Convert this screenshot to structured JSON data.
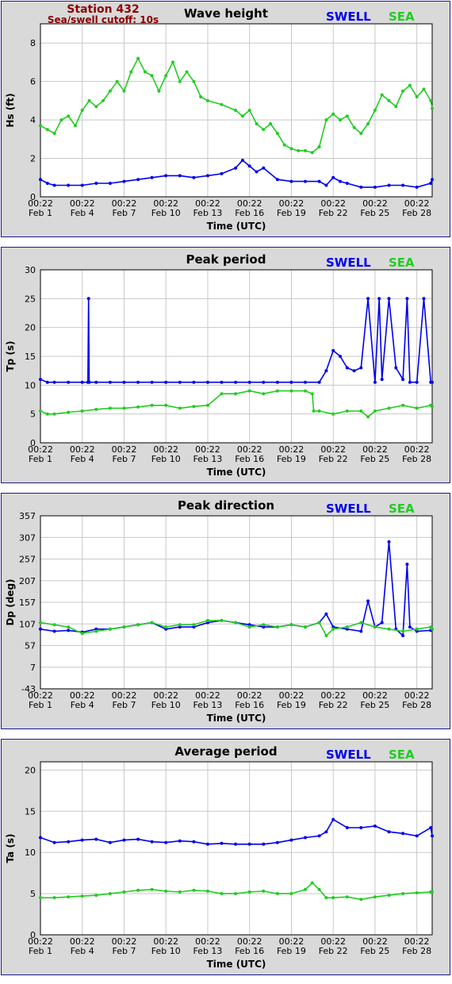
{
  "station": {
    "name": "Station 432",
    "cutoff": "Sea/swell cutoff: 10s"
  },
  "legend": {
    "swell": "SWELL",
    "sea": "SEA"
  },
  "colors": {
    "swell": "#0000ee",
    "sea": "#22cc22",
    "grid": "#c8c8c8",
    "panel_bg": "#d9d9d9",
    "border": "#1a1a8c",
    "station": "#8b0000"
  },
  "x_axis": {
    "label": "Time (UTC)",
    "ticks": [
      {
        "day": 1,
        "time": "00:22",
        "date": "Feb 1"
      },
      {
        "day": 4,
        "time": "00:22",
        "date": "Feb 4"
      },
      {
        "day": 7,
        "time": "00:22",
        "date": "Feb 7"
      },
      {
        "day": 10,
        "time": "00:22",
        "date": "Feb 10"
      },
      {
        "day": 13,
        "time": "00:22",
        "date": "Feb 13"
      },
      {
        "day": 16,
        "time": "00:22",
        "date": "Feb 16"
      },
      {
        "day": 19,
        "time": "00:22",
        "date": "Feb 19"
      },
      {
        "day": 22,
        "time": "00:22",
        "date": "Feb 22"
      },
      {
        "day": 25,
        "time": "00:22",
        "date": "Feb 25"
      },
      {
        "day": 28,
        "time": "00:22",
        "date": "Feb 28"
      }
    ],
    "range": [
      1,
      29.1
    ]
  },
  "chart_data": [
    {
      "type": "line",
      "title": "Wave height",
      "ylabel": "Hs (ft)",
      "ylim": [
        0,
        9
      ],
      "yticks": [
        0,
        2,
        4,
        6,
        8
      ],
      "series": [
        {
          "name": "SWELL",
          "x": [
            1,
            1.5,
            2,
            3,
            4,
            5,
            6,
            7,
            8,
            9,
            10,
            11,
            12,
            13,
            14,
            15,
            15.5,
            16,
            16.5,
            17,
            18,
            19,
            20,
            21,
            21.5,
            22,
            22.5,
            23,
            24,
            25,
            26,
            27,
            28,
            29,
            29.1
          ],
          "values": [
            0.9,
            0.7,
            0.6,
            0.6,
            0.6,
            0.7,
            0.7,
            0.8,
            0.9,
            1.0,
            1.1,
            1.1,
            1.0,
            1.1,
            1.2,
            1.5,
            1.9,
            1.6,
            1.3,
            1.5,
            0.9,
            0.8,
            0.8,
            0.8,
            0.6,
            1.0,
            0.8,
            0.7,
            0.5,
            0.5,
            0.6,
            0.6,
            0.5,
            0.7,
            0.9
          ]
        },
        {
          "name": "SEA",
          "x": [
            1,
            1.5,
            2,
            2.5,
            3,
            3.5,
            4,
            4.5,
            5,
            5.5,
            6,
            6.5,
            7,
            7.5,
            8,
            8.5,
            9,
            9.5,
            10,
            10.5,
            11,
            11.5,
            12,
            12.5,
            13,
            14,
            15,
            15.5,
            16,
            16.5,
            17,
            17.5,
            18,
            18.5,
            19,
            19.5,
            20,
            20.5,
            21,
            21.5,
            22,
            22.5,
            23,
            23.5,
            24,
            24.5,
            25,
            25.5,
            26,
            26.5,
            27,
            27.5,
            28,
            28.5,
            29,
            29.1
          ],
          "values": [
            3.7,
            3.5,
            3.3,
            4.0,
            4.2,
            3.7,
            4.5,
            5.0,
            4.7,
            5.0,
            5.5,
            6.0,
            5.5,
            6.5,
            7.2,
            6.5,
            6.3,
            5.5,
            6.3,
            7.0,
            6.0,
            6.5,
            6.0,
            5.2,
            5.0,
            4.8,
            4.5,
            4.2,
            4.5,
            3.8,
            3.5,
            3.8,
            3.3,
            2.7,
            2.5,
            2.4,
            2.4,
            2.3,
            2.6,
            4.0,
            4.3,
            4.0,
            4.2,
            3.6,
            3.3,
            3.8,
            4.5,
            5.3,
            5.0,
            4.7,
            5.5,
            5.8,
            5.2,
            5.6,
            5.0,
            4.6
          ]
        }
      ]
    },
    {
      "type": "line",
      "title": "Peak period",
      "ylabel": "Tp (s)",
      "ylim": [
        0,
        30
      ],
      "yticks": [
        0,
        5,
        10,
        15,
        20,
        25,
        30
      ],
      "series": [
        {
          "name": "SWELL",
          "x": [
            1,
            1.5,
            2,
            3,
            4,
            4.4,
            4.45,
            4.5,
            5,
            6,
            7,
            8,
            9,
            10,
            11,
            12,
            13,
            14,
            15,
            16,
            17,
            18,
            19,
            20,
            21,
            21.5,
            22,
            22.5,
            23,
            23.5,
            24,
            24.5,
            25,
            25.3,
            25.5,
            26,
            26.5,
            27,
            27.3,
            27.5,
            28,
            28.5,
            29,
            29.1
          ],
          "values": [
            11,
            10.5,
            10.5,
            10.5,
            10.5,
            10.5,
            25,
            10.5,
            10.5,
            10.5,
            10.5,
            10.5,
            10.5,
            10.5,
            10.5,
            10.5,
            10.5,
            10.5,
            10.5,
            10.5,
            10.5,
            10.5,
            10.5,
            10.5,
            10.5,
            12.5,
            16,
            15,
            13,
            12.5,
            13,
            25,
            10.5,
            25,
            11,
            25,
            13,
            11,
            25,
            10.5,
            10.5,
            25,
            10.5,
            10.5
          ]
        },
        {
          "name": "SEA",
          "x": [
            1,
            1.5,
            2,
            3,
            4,
            5,
            6,
            7,
            8,
            9,
            10,
            11,
            12,
            13,
            14,
            15,
            16,
            17,
            18,
            19,
            20,
            20.5,
            20.6,
            21,
            22,
            23,
            24,
            24.5,
            25,
            26,
            27,
            28,
            29,
            29.1
          ],
          "values": [
            5.5,
            5,
            5,
            5.3,
            5.5,
            5.8,
            6,
            6,
            6.2,
            6.5,
            6.5,
            6,
            6.3,
            6.5,
            8.5,
            8.5,
            9,
            8.5,
            9,
            9,
            9,
            8.5,
            5.5,
            5.5,
            5,
            5.5,
            5.5,
            4.5,
            5.5,
            6,
            6.5,
            6,
            6.5,
            6.3
          ]
        }
      ]
    },
    {
      "type": "line",
      "title": "Peak direction",
      "ylabel": "Dp (deg)",
      "ylim": [
        -43,
        357
      ],
      "yticks": [
        -43,
        7,
        57,
        107,
        157,
        207,
        257,
        307,
        357
      ],
      "series": [
        {
          "name": "SWELL",
          "x": [
            1,
            2,
            3,
            4,
            5,
            6,
            7,
            8,
            9,
            10,
            11,
            12,
            13,
            14,
            15,
            16,
            17,
            18,
            19,
            20,
            21,
            21.5,
            22,
            23,
            24,
            24.5,
            25,
            25.5,
            26,
            26.5,
            27,
            27.3,
            27.5,
            28,
            29,
            29.1
          ],
          "values": [
            95,
            90,
            92,
            88,
            95,
            95,
            100,
            105,
            110,
            95,
            100,
            100,
            110,
            115,
            110,
            105,
            100,
            100,
            105,
            100,
            110,
            130,
            100,
            95,
            90,
            160,
            100,
            110,
            297,
            95,
            80,
            245,
            100,
            90,
            92,
            95
          ]
        },
        {
          "name": "SEA",
          "x": [
            1,
            2,
            3,
            4,
            5,
            6,
            7,
            8,
            9,
            10,
            11,
            12,
            13,
            14,
            15,
            16,
            17,
            18,
            19,
            20,
            21,
            21.5,
            22,
            23,
            24,
            25,
            26,
            27,
            28,
            29,
            29.1
          ],
          "values": [
            110,
            105,
            100,
            85,
            90,
            95,
            100,
            105,
            110,
            100,
            105,
            105,
            115,
            115,
            110,
            100,
            105,
            100,
            105,
            100,
            110,
            80,
            95,
            100,
            110,
            100,
            95,
            90,
            95,
            100,
            95
          ]
        }
      ]
    },
    {
      "type": "line",
      "title": "Average period",
      "ylabel": "Ta (s)",
      "ylim": [
        0,
        21
      ],
      "yticks": [
        0,
        5,
        10,
        15,
        20
      ],
      "series": [
        {
          "name": "SWELL",
          "x": [
            1,
            2,
            3,
            4,
            5,
            6,
            7,
            8,
            9,
            10,
            11,
            12,
            13,
            14,
            15,
            16,
            17,
            18,
            19,
            20,
            21,
            21.5,
            22,
            23,
            24,
            25,
            26,
            27,
            28,
            29,
            29.1
          ],
          "values": [
            11.8,
            11.2,
            11.3,
            11.5,
            11.6,
            11.2,
            11.5,
            11.6,
            11.3,
            11.2,
            11.4,
            11.3,
            11.0,
            11.1,
            11.0,
            11.0,
            11.0,
            11.2,
            11.5,
            11.8,
            12.0,
            12.5,
            14.0,
            13.0,
            13.0,
            13.2,
            12.5,
            12.3,
            12.0,
            13.0,
            12.0
          ]
        },
        {
          "name": "SEA",
          "x": [
            1,
            2,
            3,
            4,
            5,
            6,
            7,
            8,
            9,
            10,
            11,
            12,
            13,
            14,
            15,
            16,
            17,
            18,
            19,
            20,
            20.5,
            21,
            21.5,
            22,
            23,
            24,
            25,
            26,
            27,
            28,
            29,
            29.1
          ],
          "values": [
            4.5,
            4.5,
            4.6,
            4.7,
            4.8,
            5.0,
            5.2,
            5.4,
            5.5,
            5.3,
            5.2,
            5.4,
            5.3,
            5.0,
            5.0,
            5.2,
            5.3,
            5.0,
            5.0,
            5.5,
            6.3,
            5.5,
            4.5,
            4.5,
            4.6,
            4.3,
            4.6,
            4.8,
            5.0,
            5.1,
            5.2,
            5.2
          ]
        }
      ]
    }
  ]
}
